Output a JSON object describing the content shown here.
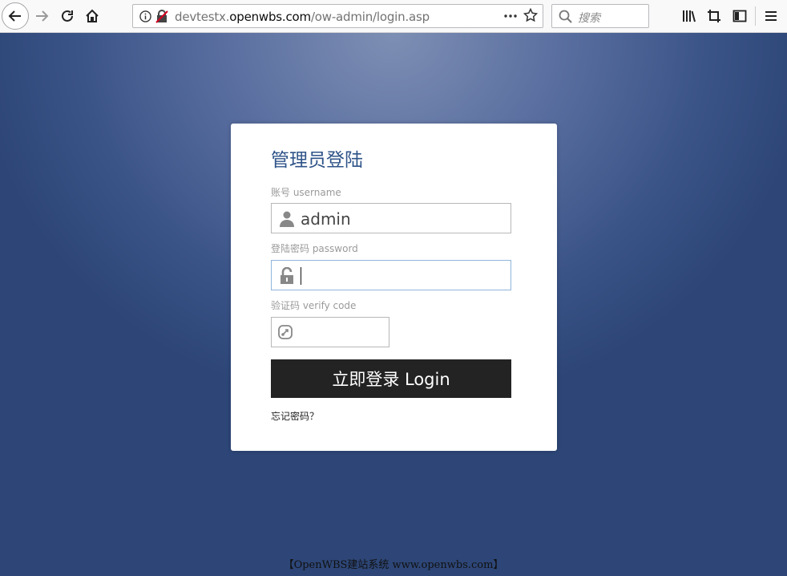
{
  "browser": {
    "url_prefix": "devtestx.",
    "url_host": "openwbs.com",
    "url_path": "/ow-admin/login.asp",
    "search_placeholder": "搜索"
  },
  "login": {
    "title": "管理员登陆",
    "username_label": "账号 username",
    "username_value": "admin",
    "password_label": "登陆密码 password",
    "verify_label": "验证码 verify code",
    "submit_label": "立即登录 Login",
    "forgot_label": "忘记密码？"
  },
  "footer": {
    "text": "【OpenWBS建站系统 www.openwbs.com】"
  }
}
